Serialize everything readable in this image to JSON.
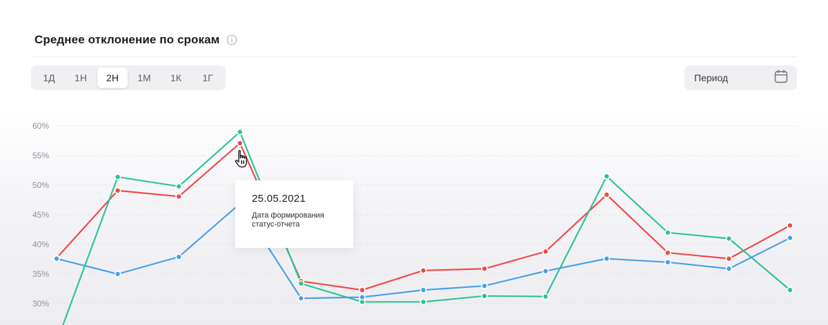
{
  "header": {
    "title": "Среднее отклонение по срокам",
    "info_icon": "info-icon"
  },
  "range_buttons": [
    {
      "label": "1Д",
      "active": false
    },
    {
      "label": "1Н",
      "active": false
    },
    {
      "label": "2Н",
      "active": true
    },
    {
      "label": "1М",
      "active": false
    },
    {
      "label": "1К",
      "active": false
    },
    {
      "label": "1Г",
      "active": false
    }
  ],
  "period": {
    "label": "Период",
    "icon": "calendar-icon"
  },
  "tooltip": {
    "date": "25.05.2021",
    "text_line1": "Дата формирования",
    "text_line2": "статус-отчета"
  },
  "colors": {
    "red": "#ef4a4a",
    "green": "#2ec493",
    "blue": "#4a9fe8",
    "grid": "#dcdce2",
    "tick": "#8e9099"
  },
  "chart_data": {
    "type": "line",
    "y_ticks": [
      "60%",
      "55%",
      "50%",
      "45%",
      "40%",
      "35%",
      "30%"
    ],
    "ylim": [
      30,
      60
    ],
    "grid": true,
    "legend": "none",
    "point_count": 12,
    "series": [
      {
        "color": "#ef4a4a",
        "values": [
          37.7,
          49.1,
          48.1,
          57.1,
          33.8,
          32.3,
          35.6,
          35.9,
          38.8,
          48.4,
          38.6,
          37.6,
          43.2
        ]
      },
      {
        "color": "#2ec493",
        "values": [
          null,
          51.4,
          49.8,
          59.0,
          33.4,
          30.3,
          30.3,
          31.3,
          31.2,
          51.5,
          42.0,
          41.0,
          32.3
        ]
      },
      {
        "color": "#4a9fe8",
        "values": [
          37.6,
          35.0,
          37.9,
          46.9,
          30.9,
          31.1,
          32.3,
          33.0,
          35.5,
          37.6,
          37.0,
          35.9,
          41.1
        ]
      }
    ],
    "green_start": 26.0,
    "tooltip_index": 3
  }
}
